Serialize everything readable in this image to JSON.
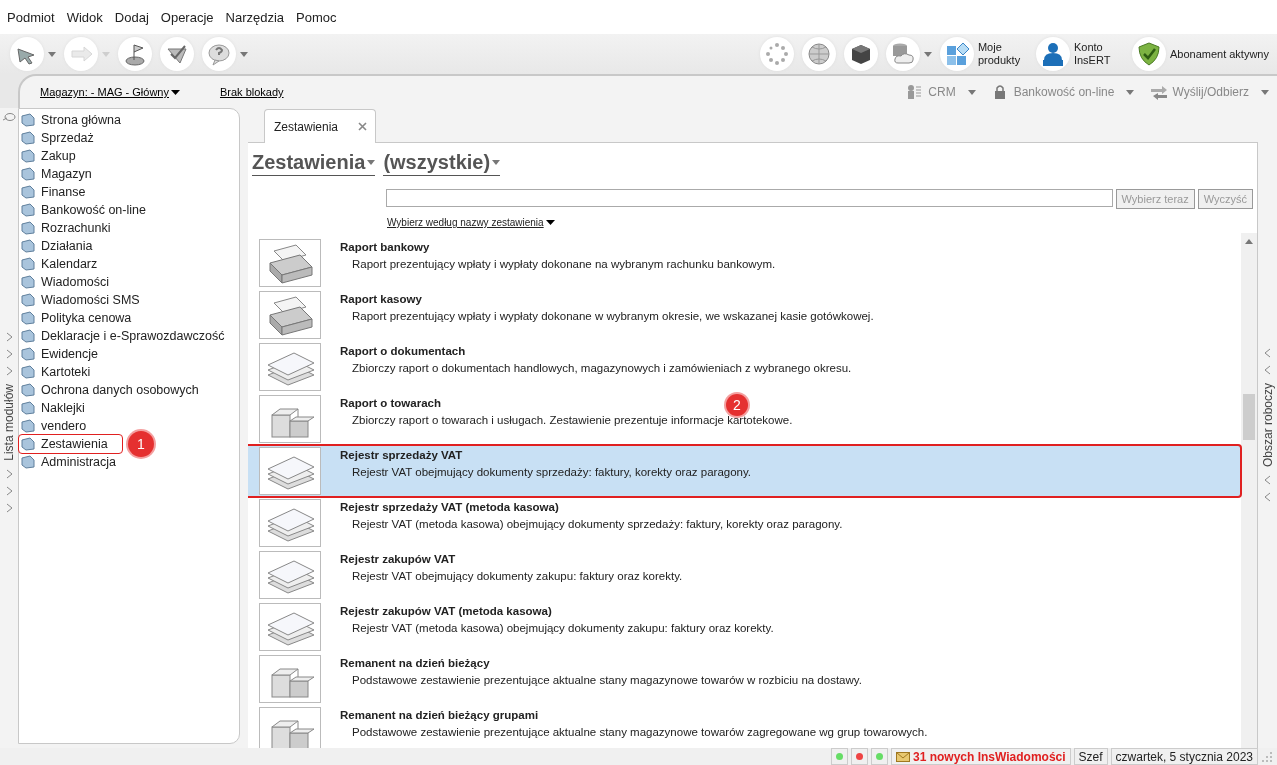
{
  "menu": [
    "Podmiot",
    "Widok",
    "Dodaj",
    "Operacje",
    "Narzędzia",
    "Pomoc"
  ],
  "toolbar_left": [
    {
      "kind": "arrow-out",
      "dropdown": true
    },
    {
      "kind": "arrow-in",
      "dropdown": true,
      "disabled": true
    },
    {
      "kind": "flag",
      "dropdown": false
    },
    {
      "kind": "check",
      "dropdown": false
    },
    {
      "kind": "help",
      "dropdown": true
    }
  ],
  "toolbar_right": [
    {
      "kind": "spinner",
      "dropdown": false
    },
    {
      "kind": "globe",
      "dropdown": false
    },
    {
      "kind": "cube",
      "dropdown": false
    },
    {
      "kind": "cloud",
      "dropdown": true
    },
    {
      "kind": "tiles",
      "label": "Moje produkty"
    },
    {
      "kind": "person",
      "label": "Konto InsERT"
    },
    {
      "kind": "shield",
      "label": "Abonament aktywny"
    }
  ],
  "subbar": {
    "warehouse": "Magazyn: - MAG - Główny",
    "lock": "Brak blokady",
    "actions": [
      {
        "kind": "crm",
        "label": "CRM"
      },
      {
        "kind": "bank",
        "label": "Bankowość on-line"
      },
      {
        "kind": "send",
        "label": "Wyślij/Odbierz"
      }
    ]
  },
  "left_strip": {
    "title": "Lista modułów"
  },
  "sidebar": {
    "items": [
      {
        "label": "Strona główna"
      },
      {
        "label": "Sprzedaż"
      },
      {
        "label": "Zakup"
      },
      {
        "label": "Magazyn"
      },
      {
        "label": "Finanse"
      },
      {
        "label": "Bankowość on-line"
      },
      {
        "label": "Rozrachunki"
      },
      {
        "label": "Działania"
      },
      {
        "label": "Kalendarz"
      },
      {
        "label": "Wiadomości"
      },
      {
        "label": "Wiadomości SMS"
      },
      {
        "label": "Polityka cenowa"
      },
      {
        "label": "Deklaracje i e-Sprawozdawczość"
      },
      {
        "label": "Ewidencje"
      },
      {
        "label": "Kartoteki"
      },
      {
        "label": "Ochrona danych osobowych"
      },
      {
        "label": "Naklejki"
      },
      {
        "label": "vendero"
      },
      {
        "label": "Zestawienia",
        "outlined": true,
        "callout": "1"
      },
      {
        "label": "Administracja"
      }
    ]
  },
  "tabs": [
    {
      "label": "Zestawienia",
      "selected": true
    }
  ],
  "heading": {
    "title": "Zestawienia",
    "filter": "(wszystkie)"
  },
  "search": {
    "button": "Wybierz teraz",
    "clear": "Wyczyść",
    "mode": "Wybierz według nazwy zestawienia"
  },
  "reports": [
    {
      "kind": "printer",
      "title": "Raport bankowy",
      "description": "Raport prezentujący wpłaty i wypłaty dokonane na wybranym rachunku bankowym.",
      "selected": false
    },
    {
      "kind": "printer",
      "title": "Raport kasowy",
      "description": "Raport prezentujący wpłaty i wypłaty dokonane w wybranym okresie, we wskazanej kasie gotówkowej.",
      "selected": false
    },
    {
      "kind": "stack",
      "title": "Raport o dokumentach",
      "description": "Zbiorczy raport o dokumentach handlowych, magazynowych i zamówieniach z wybranego okresu.",
      "selected": false
    },
    {
      "kind": "boxes",
      "title": "Raport o towarach",
      "description": "Zbiorczy raport o towarach i usługach. Zestawienie prezentuje informacje kartotekowe.",
      "selected": false,
      "callout": "2"
    },
    {
      "kind": "stack",
      "title": "Rejestr sprzedaży VAT",
      "description": "Rejestr VAT obejmujący dokumenty sprzedaży: faktury, korekty oraz paragony.",
      "selected": true,
      "outlined": true
    },
    {
      "kind": "stack",
      "title": "Rejestr sprzedaży VAT (metoda kasowa)",
      "description": "Rejestr VAT (metoda kasowa) obejmujący dokumenty sprzedaży: faktury, korekty oraz paragony.",
      "selected": false
    },
    {
      "kind": "stack",
      "title": "Rejestr zakupów VAT",
      "description": "Rejestr VAT obejmujący dokumenty zakupu: faktury oraz korekty.",
      "selected": false
    },
    {
      "kind": "stack",
      "title": "Rejestr zakupów VAT (metoda kasowa)",
      "description": "Rejestr VAT (metoda kasowa) obejmujący dokumenty zakupu: faktury oraz korekty.",
      "selected": false
    },
    {
      "kind": "boxes",
      "title": "Remanent na dzień bieżący",
      "description": "Podstawowe zestawienie prezentujące aktualne stany magazynowe towarów w rozbiciu na dostawy.",
      "selected": false
    },
    {
      "kind": "boxes",
      "title": "Remanent na dzień bieżący grupami",
      "description": "Podstawowe zestawienie prezentujące aktualne stany magazynowe towarów zagregowane wg grup towarowych.",
      "selected": false
    }
  ],
  "right_strip": {
    "title": "Obszar roboczy"
  },
  "status_bar": {
    "lights": [
      {
        "color": "#66dd66"
      },
      {
        "color": "#ee4444"
      },
      {
        "color": "#66dd66"
      }
    ],
    "messages": "31 nowych InsWiadomości",
    "user": "Szef",
    "date": "czwartek, 5 stycznia 2023"
  }
}
